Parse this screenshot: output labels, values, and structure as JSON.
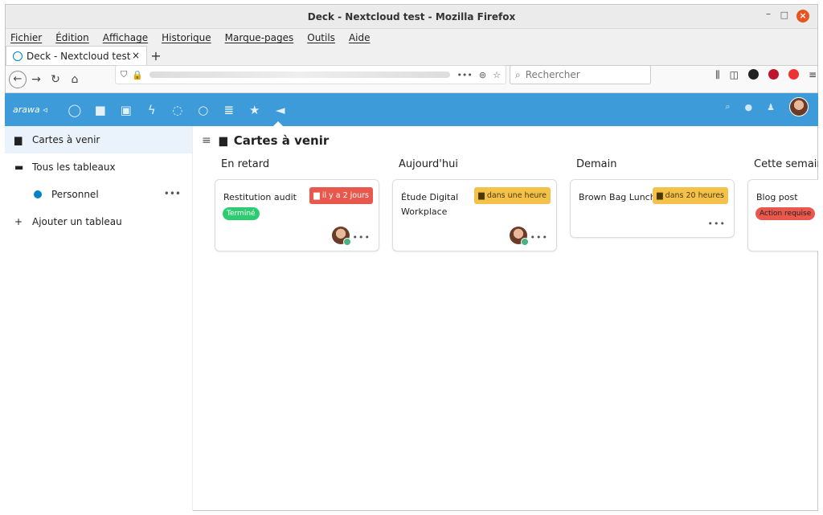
{
  "window": {
    "title": "Deck - Nextcloud test - Mozilla Firefox",
    "minimize": "–",
    "maximize": "□",
    "close": "×"
  },
  "menu": [
    "Fichier",
    "Édition",
    "Affichage",
    "Historique",
    "Marque-pages",
    "Outils",
    "Aide"
  ],
  "tab": {
    "label": "Deck - Nextcloud test",
    "close": "×",
    "new_tab": "+"
  },
  "nav": {
    "url_more": "•••",
    "search_placeholder": "Rechercher"
  },
  "header": {
    "logo": "arawa ◃"
  },
  "sidebar": {
    "items": [
      {
        "label": "Cartes à venir",
        "icon": "calendar-icon"
      },
      {
        "label": "Tous les tableaux",
        "icon": "stack-icon"
      },
      {
        "label": "Personnel",
        "icon": "bullet",
        "color": "#0082c9",
        "more": "•••"
      },
      {
        "label": "Ajouter un tableau",
        "icon": "plus-icon"
      }
    ]
  },
  "main": {
    "title": "Cartes à venir"
  },
  "stacks": [
    {
      "title": "En retard",
      "cards": [
        {
          "title": "Restitution audit",
          "due": "il y a 2 jours",
          "due_type": "overdue",
          "label": "Terminé",
          "label_color": "#2ecc71",
          "has_avatar": true
        }
      ]
    },
    {
      "title": "Aujourd'hui",
      "cards": [
        {
          "title": "Étude Digital Workplace",
          "due": "dans une heure",
          "due_type": "soon",
          "has_avatar": true
        }
      ]
    },
    {
      "title": "Demain",
      "cards": [
        {
          "title": "Brown Bag Lunch",
          "due": "dans 20 heures",
          "due_type": "soon",
          "has_avatar": false
        }
      ]
    },
    {
      "title": "Cette semaine",
      "cards": [
        {
          "title": "Blog post",
          "label": "Action requise",
          "label_color": "#e9584c",
          "has_avatar": false
        }
      ]
    }
  ],
  "card_more": "•••"
}
